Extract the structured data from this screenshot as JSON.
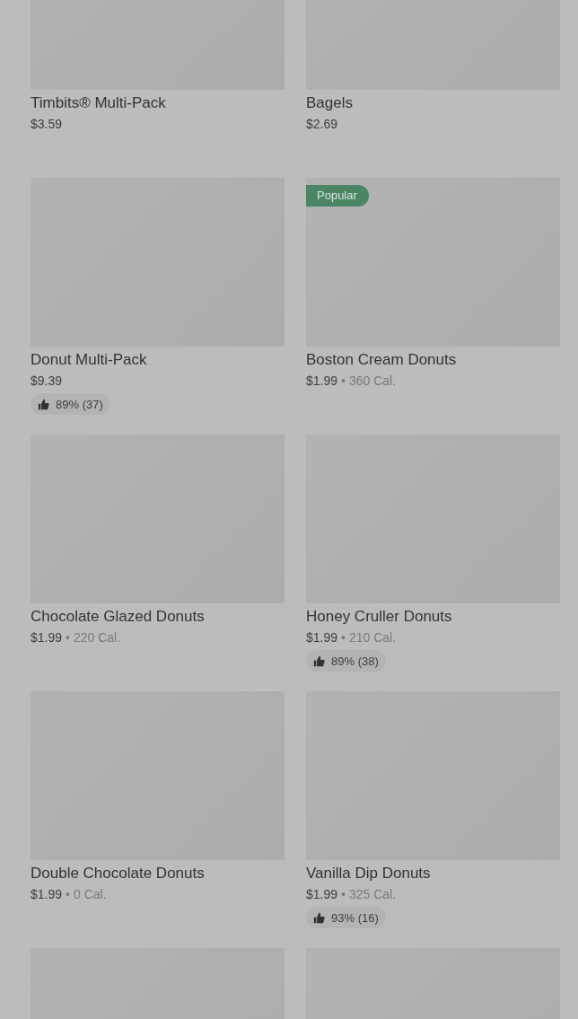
{
  "rows": [
    {
      "cards": [
        {
          "kind": "item",
          "name": "Timbits® Multi-Pack",
          "price": "$3.59"
        },
        {
          "kind": "item",
          "name": "Bagels",
          "price": "$2.69"
        }
      ]
    },
    {
      "cards": [
        {
          "kind": "item",
          "name": "Donut Multi-Pack",
          "price": "$9.39",
          "rating": "89% (37)"
        },
        {
          "kind": "item",
          "badge": "Popular",
          "name": "Boston Cream Donuts",
          "price": "$1.99",
          "separator": "•",
          "calories": "360 Cal."
        }
      ]
    },
    {
      "cards": [
        {
          "kind": "item",
          "name": "Chocolate Glazed Donuts",
          "price": "$1.99",
          "separator": "•",
          "calories": "220 Cal."
        },
        {
          "kind": "item",
          "name": "Honey Cruller Donuts",
          "price": "$1.99",
          "separator": "•",
          "calories": "210 Cal.",
          "rating": "89% (38)"
        }
      ]
    },
    {
      "cards": [
        {
          "kind": "item",
          "name": "Double Chocolate Donuts",
          "price": "$1.99",
          "separator": "•",
          "calories": "0 Cal."
        },
        {
          "kind": "item",
          "name": "Vanilla Dip Donuts",
          "price": "$1.99",
          "separator": "•",
          "calories": "325 Cal.",
          "rating": "93% (16)"
        }
      ]
    },
    {
      "cards": [
        {
          "kind": "picture"
        },
        {
          "kind": "picture"
        }
      ]
    }
  ]
}
